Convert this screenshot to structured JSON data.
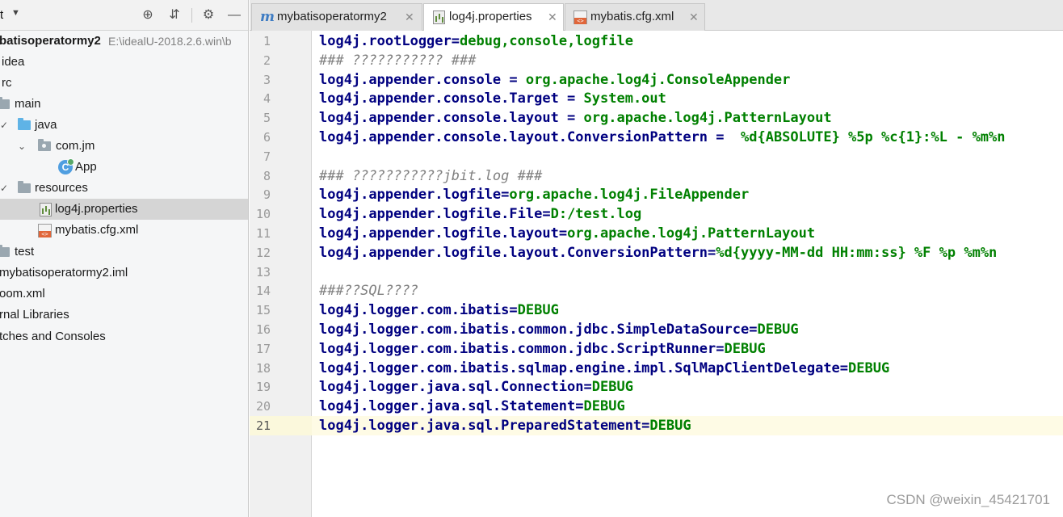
{
  "project_panel": {
    "title": "t",
    "tree": [
      {
        "label": "batisoperatormy2",
        "path": "E:\\idealU-2018.2.6.win\\b",
        "kind": "module"
      },
      {
        "label": "idea",
        "kind": "folder"
      },
      {
        "label": "rc",
        "kind": "folder"
      },
      {
        "label": "main",
        "kind": "folder"
      },
      {
        "label": "java",
        "kind": "source-folder"
      },
      {
        "label": "com.jm",
        "kind": "package"
      },
      {
        "label": "App",
        "kind": "class"
      },
      {
        "label": "resources",
        "kind": "folder"
      },
      {
        "label": "log4j.properties",
        "kind": "properties-file"
      },
      {
        "label": "mybatis.cfg.xml",
        "kind": "xml-file"
      },
      {
        "label": "test",
        "kind": "folder"
      },
      {
        "label": "mybatisoperatormy2.iml",
        "kind": "file"
      },
      {
        "label": "oom.xml",
        "kind": "file"
      },
      {
        "label": "rnal Libraries",
        "kind": "library"
      },
      {
        "label": "tches and Consoles",
        "kind": "scratches"
      }
    ]
  },
  "tabs": [
    {
      "label": "mybatisoperatormy2",
      "icon": "m-icon"
    },
    {
      "label": "log4j.properties",
      "icon": "properties-icon",
      "active": true
    },
    {
      "label": "mybatis.cfg.xml",
      "icon": "xml-icon"
    }
  ],
  "editor": {
    "line_numbers": [
      "1",
      "2",
      "3",
      "4",
      "5",
      "6",
      "7",
      "8",
      "9",
      "10",
      "11",
      "12",
      "13",
      "14",
      "15",
      "16",
      "17",
      "18",
      "19",
      "20",
      "21"
    ],
    "current_line": "21",
    "lines": [
      {
        "k": "log4j.rootLogger",
        "s": "=",
        "v": "debug,console,logfile"
      },
      {
        "c": "### ??????????? ###"
      },
      {
        "k": "log4j.appender.console",
        "s": " = ",
        "v": "org.apache.log4j.ConsoleAppender"
      },
      {
        "k": "log4j.appender.console.Target",
        "s": " = ",
        "v": "System.out"
      },
      {
        "k": "log4j.appender.console.layout",
        "s": " = ",
        "v": "org.apache.log4j.PatternLayout"
      },
      {
        "k": "log4j.appender.console.layout.ConversionPattern",
        "s": " =  ",
        "v": "%d{ABSOLUTE} %5p %c{1}:%L - %m%n"
      },
      {
        "c": ""
      },
      {
        "c": "### ???????????jbit.log ###"
      },
      {
        "k": "log4j.appender.logfile",
        "s": "=",
        "v": "org.apache.log4j.FileAppender"
      },
      {
        "k": "log4j.appender.logfile.File",
        "s": "=",
        "v": "D:/test.log"
      },
      {
        "k": "log4j.appender.logfile.layout",
        "s": "=",
        "v": "org.apache.log4j.PatternLayout"
      },
      {
        "k": "log4j.appender.logfile.layout.ConversionPattern",
        "s": "=",
        "v": "%d{yyyy-MM-dd HH:mm:ss} %F %p %m%n"
      },
      {
        "c": ""
      },
      {
        "c": "###??SQL????"
      },
      {
        "k": "log4j.logger.com.ibatis",
        "s": "=",
        "v": "DEBUG"
      },
      {
        "k": "log4j.logger.com.ibatis.common.jdbc.SimpleDataSource",
        "s": "=",
        "v": "DEBUG"
      },
      {
        "k": "log4j.logger.com.ibatis.common.jdbc.ScriptRunner",
        "s": "=",
        "v": "DEBUG"
      },
      {
        "k": "log4j.logger.com.ibatis.sqlmap.engine.impl.SqlMapClientDelegate",
        "s": "=",
        "v": "DEBUG"
      },
      {
        "k": "log4j.logger.java.sql.Connection",
        "s": "=",
        "v": "DEBUG"
      },
      {
        "k": "log4j.logger.java.sql.Statement",
        "s": "=",
        "v": "DEBUG"
      },
      {
        "k": "log4j.logger.java.sql.PreparedStatement",
        "s": "=",
        "v": "DEBUG"
      }
    ]
  },
  "watermark": "CSDN @weixin_45421701",
  "colors": {
    "key": "#000080",
    "value": "#008000",
    "comment": "#808080",
    "current_line": "#fefbe5",
    "selection": "#d5d5d5"
  }
}
